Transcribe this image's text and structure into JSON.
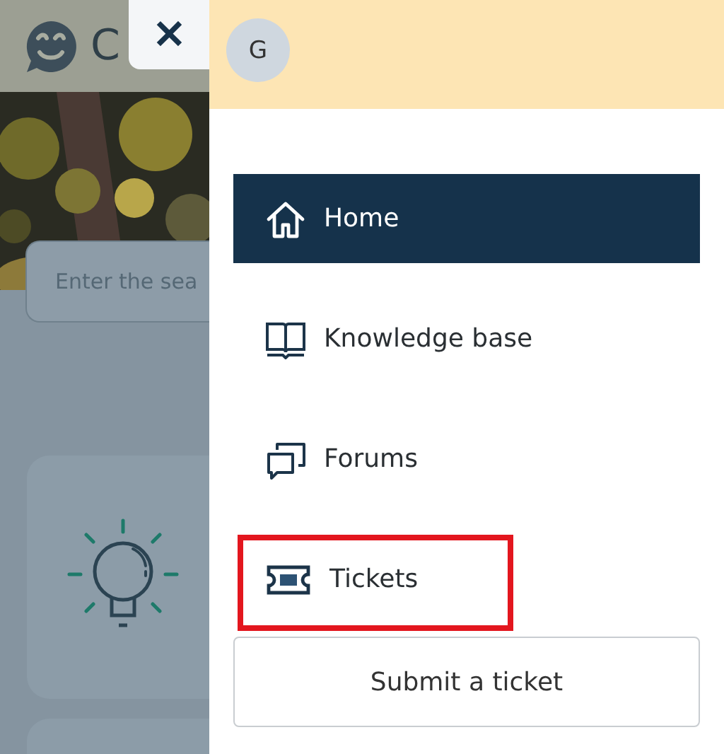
{
  "page": {
    "site_title": "C",
    "search": {
      "placeholder": "Enter the sea"
    }
  },
  "close_button": {
    "label": "✕"
  },
  "drawer": {
    "avatar": {
      "initial": "G"
    },
    "nav_items": [
      {
        "label": "Home",
        "kind": "home",
        "selected": true,
        "annotated": false
      },
      {
        "label": "Knowledge base",
        "kind": "book",
        "selected": false,
        "annotated": false
      },
      {
        "label": "Forums",
        "kind": "chat",
        "selected": false,
        "annotated": false
      },
      {
        "label": "Tickets",
        "kind": "ticket",
        "selected": false,
        "annotated": true
      }
    ],
    "submit_button": {
      "label": "Submit a ticket"
    }
  }
}
